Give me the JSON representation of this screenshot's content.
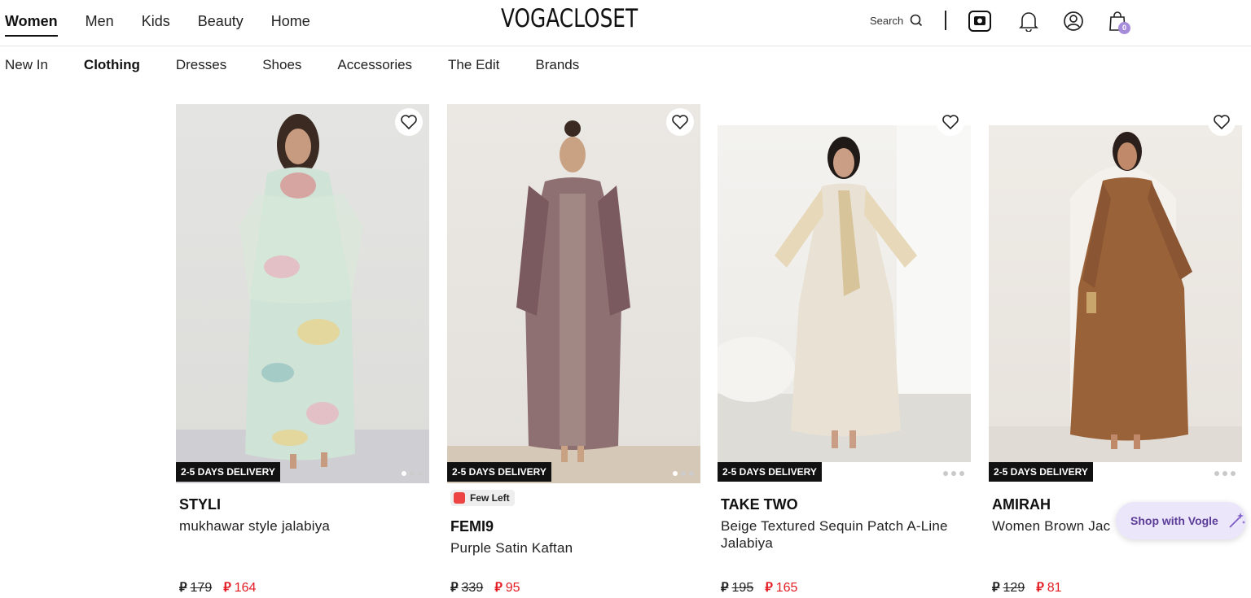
{
  "header": {
    "gender_tabs": [
      {
        "label": "Women",
        "active": true
      },
      {
        "label": "Men",
        "active": false
      },
      {
        "label": "Kids",
        "active": false
      },
      {
        "label": "Beauty",
        "active": false
      },
      {
        "label": "Home",
        "active": false
      }
    ],
    "logo": "VOGACLOSET",
    "search_label": "Search",
    "cart_count": "0"
  },
  "categories": [
    {
      "label": "New In",
      "active": false
    },
    {
      "label": "Clothing",
      "active": true
    },
    {
      "label": "Dresses",
      "active": false
    },
    {
      "label": "Shoes",
      "active": false
    },
    {
      "label": "Accessories",
      "active": false
    },
    {
      "label": "The Edit",
      "active": false
    },
    {
      "label": "Brands",
      "active": false
    }
  ],
  "products": [
    {
      "brand": "STYLI",
      "name": "mukhawar style jalabiya",
      "delivery": "2-5 DAYS DELIVERY",
      "old_price": "179",
      "new_price": "164",
      "badge": ""
    },
    {
      "brand": "FEMI9",
      "name": "Purple Satin Kaftan",
      "delivery": "2-5 DAYS DELIVERY",
      "old_price": "339",
      "new_price": "95",
      "badge": "Few Left"
    },
    {
      "brand": "TAKE TWO",
      "name": "Beige Textured Sequin Patch A-Line Jalabiya",
      "delivery": "2-5 DAYS DELIVERY",
      "old_price": "195",
      "new_price": "165",
      "badge": ""
    },
    {
      "brand": "AMIRAH",
      "name": "Women Brown Jac",
      "delivery": "2-5 DAYS DELIVERY",
      "old_price": "129",
      "new_price": "81",
      "badge": ""
    }
  ],
  "currency_symbol": "⃁",
  "assistant": {
    "label": "Shop with Vogle"
  },
  "colors": {
    "accent": "#a78bdb",
    "sale": "#e31b23",
    "delivery_bg": "#111111"
  }
}
